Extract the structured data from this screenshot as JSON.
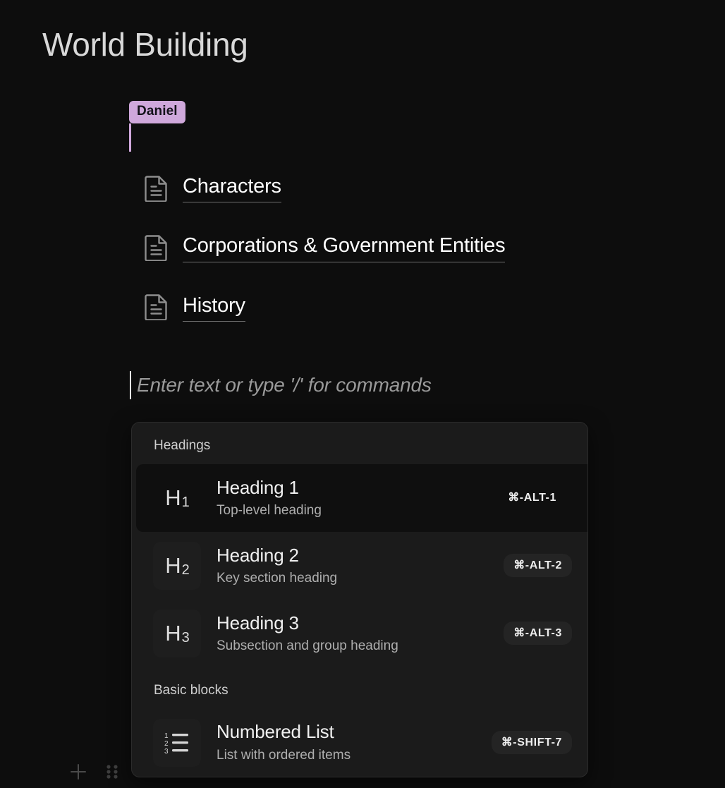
{
  "document": {
    "title": "World Building",
    "placeholder": "Enter text or type '/' for commands"
  },
  "collaborator": {
    "name": "Daniel",
    "color": "#cfa8db",
    "label_text_color": "#14121a"
  },
  "doc_links": [
    {
      "label": "Characters",
      "icon": "document-icon"
    },
    {
      "label": "Corporations & Government Entities",
      "icon": "document-icon"
    },
    {
      "label": "History",
      "icon": "document-icon"
    }
  ],
  "slash_menu": {
    "sections": [
      {
        "title": "Headings",
        "items": [
          {
            "badge": "H1",
            "badge_main": "H",
            "badge_sub": "1",
            "title": "Heading 1",
            "description": "Top-level heading",
            "shortcut": "⌘-ALT-1",
            "selected": true,
            "icon": "heading-1-icon"
          },
          {
            "badge": "H2",
            "badge_main": "H",
            "badge_sub": "2",
            "title": "Heading 2",
            "description": "Key section heading",
            "shortcut": "⌘-ALT-2",
            "selected": false,
            "icon": "heading-2-icon"
          },
          {
            "badge": "H3",
            "badge_main": "H",
            "badge_sub": "3",
            "title": "Heading 3",
            "description": "Subsection and group heading",
            "shortcut": "⌘-ALT-3",
            "selected": false,
            "icon": "heading-3-icon"
          }
        ]
      },
      {
        "title": "Basic blocks",
        "items": [
          {
            "badge": "",
            "title": "Numbered List",
            "description": "List with ordered items",
            "shortcut": "⌘-SHIFT-7",
            "selected": false,
            "icon": "numbered-list-icon"
          }
        ]
      }
    ]
  },
  "block_controls": {
    "add_icon": "plus-icon",
    "drag_icon": "drag-handle-icon"
  }
}
